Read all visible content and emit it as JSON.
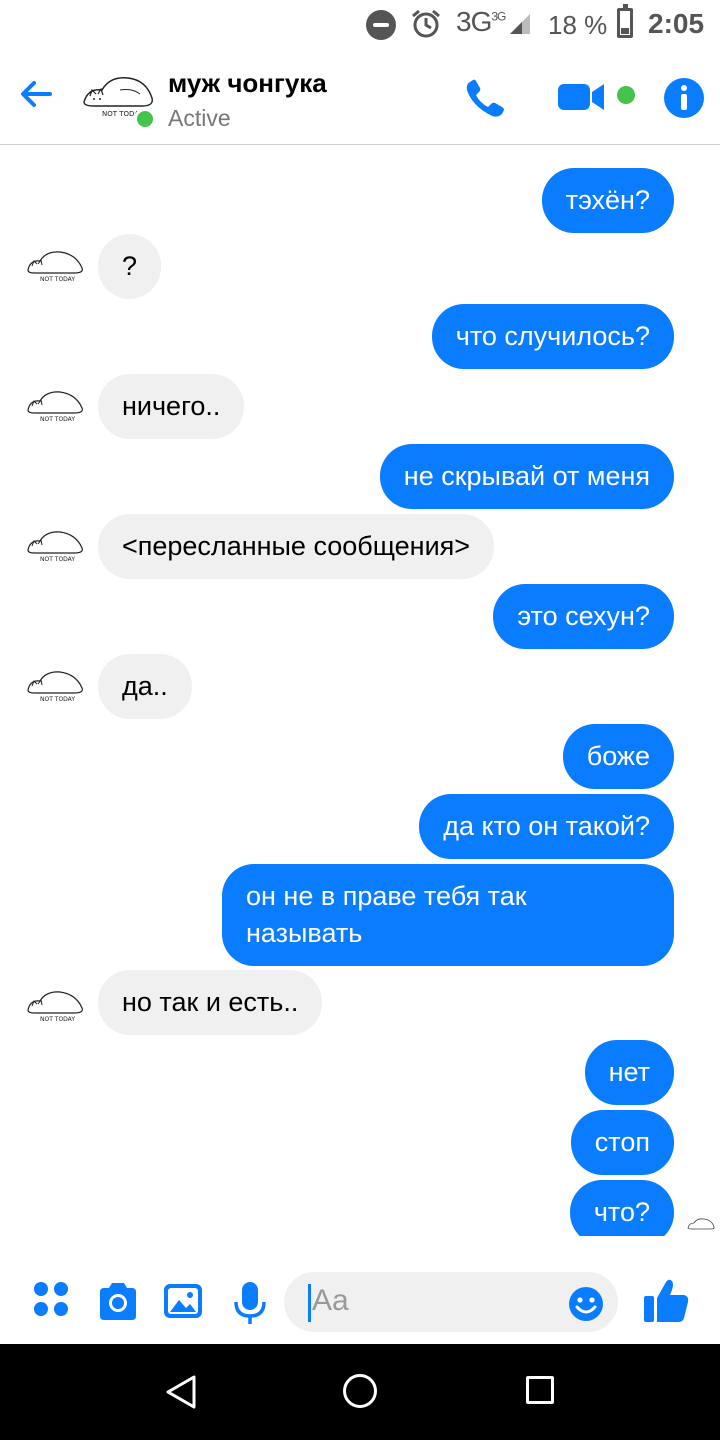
{
  "status_bar": {
    "network": "3G",
    "network_sup": "3G",
    "battery": "18 %",
    "time": "2:05"
  },
  "header": {
    "contact_name": "муж чонгука",
    "status": "Active"
  },
  "messages": [
    {
      "direction": "out",
      "text": "тэхён?"
    },
    {
      "direction": "in",
      "text": "?"
    },
    {
      "direction": "out",
      "text": "что случилось?"
    },
    {
      "direction": "in",
      "text": "ничего.."
    },
    {
      "direction": "out",
      "text": "не скрывай от меня"
    },
    {
      "direction": "in",
      "text": "<пересланные сообщения>"
    },
    {
      "direction": "out",
      "text": "это сехун?"
    },
    {
      "direction": "in",
      "text": "да.."
    },
    {
      "direction": "out",
      "text": "боже"
    },
    {
      "direction": "out",
      "text": "да кто он такой?"
    },
    {
      "direction": "out",
      "text": "он не в праве тебя так называть"
    },
    {
      "direction": "in",
      "text": "но так и есть.."
    },
    {
      "direction": "out",
      "text": "нет"
    },
    {
      "direction": "out",
      "text": "стоп"
    },
    {
      "direction": "out",
      "text": "что?"
    }
  ],
  "composer": {
    "placeholder": "Aa"
  },
  "icons": {
    "back": "arrow-left-icon",
    "call": "phone-icon",
    "video": "video-camera-icon",
    "info": "info-icon",
    "more": "four-dots-icon",
    "camera": "camera-icon",
    "gallery": "image-icon",
    "mic": "microphone-icon",
    "emoji": "smiley-icon",
    "like": "thumbs-up-icon"
  },
  "colors": {
    "accent": "#0a7cff",
    "incoming_bubble": "#f0f0f0",
    "active": "#44c44a"
  }
}
